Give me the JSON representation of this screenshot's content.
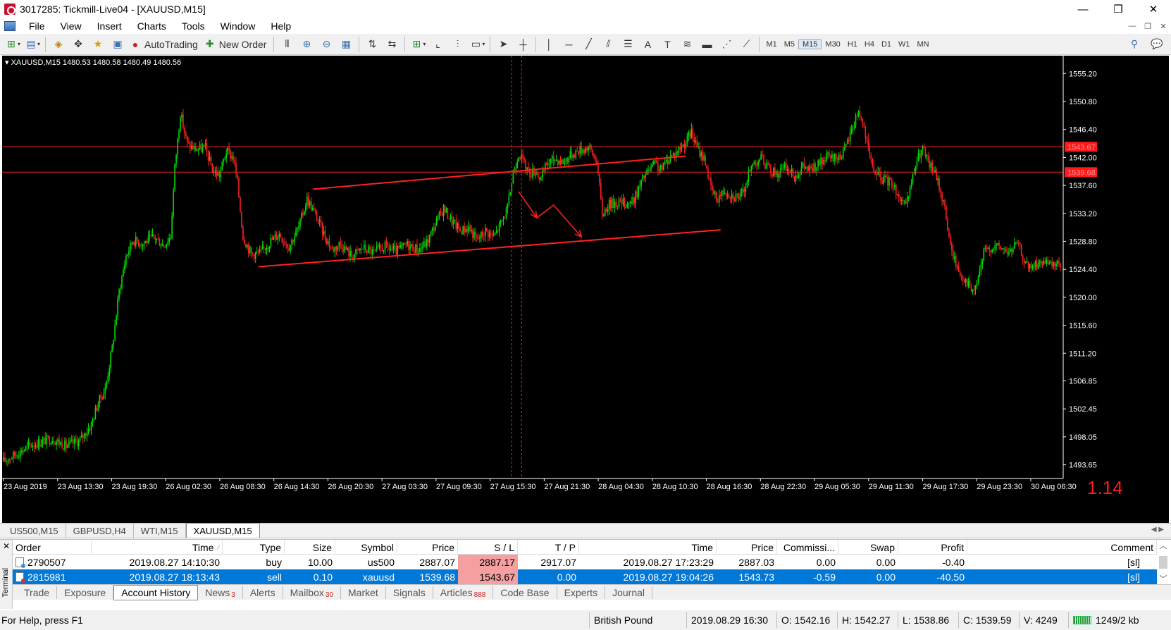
{
  "window": {
    "title": "3017285: Tickmill-Live04 - [XAUUSD,M15]",
    "controls": [
      "—",
      "❐",
      "✕"
    ]
  },
  "menu": [
    "File",
    "View",
    "Insert",
    "Charts",
    "Tools",
    "Window",
    "Help"
  ],
  "toolbar": {
    "autotrading_label": "AutoTrading",
    "new_order_label": "New Order",
    "timeframes": [
      "M1",
      "M5",
      "M15",
      "M30",
      "H1",
      "H4",
      "D1",
      "W1",
      "MN"
    ],
    "selected_timeframe": "M15"
  },
  "chart": {
    "info": "XAUUSD,M15  1480.53 1480.58 1480.49 1480.56",
    "spread_value": "1.14",
    "price_ticks": [
      "1555.20",
      "1550.80",
      "1546.40",
      "1542.00",
      "1537.60",
      "1533.20",
      "1528.80",
      "1524.40",
      "1520.00",
      "1515.60",
      "1511.20",
      "1506.85",
      "1502.45",
      "1498.05",
      "1493.65"
    ],
    "price_tag_sl": "1543.67",
    "price_tag_entry": "1539.68",
    "time_ticks": [
      "23 Aug 2019",
      "23 Aug 13:30",
      "23 Aug 19:30",
      "26 Aug 02:30",
      "26 Aug 08:30",
      "26 Aug 14:30",
      "26 Aug 20:30",
      "27 Aug 03:30",
      "27 Aug 09:30",
      "27 Aug 15:30",
      "27 Aug 21:30",
      "28 Aug 04:30",
      "28 Aug 10:30",
      "28 Aug 16:30",
      "28 Aug 22:30",
      "29 Aug 05:30",
      "29 Aug 11:30",
      "29 Aug 17:30",
      "29 Aug 23:30",
      "30 Aug 06:30"
    ],
    "colors": {
      "background": "#000000",
      "up": "#00e000",
      "down": "#ff2020",
      "annotation": "#ff2020",
      "text": "#ffffff"
    }
  },
  "chart_data": {
    "type": "candlestick",
    "symbol": "XAUUSD",
    "timeframe": "M15",
    "ylim": [
      1491.5,
      1558.0
    ],
    "close_path": [
      [
        0,
        1494.2
      ],
      [
        20,
        1496.8
      ],
      [
        35,
        1497.8
      ],
      [
        45,
        1496.6
      ],
      [
        55,
        1497.5
      ],
      [
        63,
        1500.0
      ],
      [
        68,
        1503.5
      ],
      [
        73,
        1505.5
      ],
      [
        78,
        1512.0
      ],
      [
        83,
        1521.0
      ],
      [
        88,
        1526.5
      ],
      [
        93,
        1529.0
      ],
      [
        100,
        1528.5
      ],
      [
        108,
        1529.5
      ],
      [
        115,
        1528.2
      ],
      [
        120,
        1529.6
      ],
      [
        123,
        1540.5
      ],
      [
        127,
        1549.0
      ],
      [
        132,
        1544.0
      ],
      [
        138,
        1543.3
      ],
      [
        145,
        1543.5
      ],
      [
        150,
        1540.0
      ],
      [
        155,
        1539.2
      ],
      [
        160,
        1543.0
      ],
      [
        165,
        1542.0
      ],
      [
        168,
        1538.0
      ],
      [
        172,
        1529.5
      ],
      [
        178,
        1526.8
      ],
      [
        185,
        1527.0
      ],
      [
        190,
        1528.5
      ],
      [
        198,
        1530.0
      ],
      [
        205,
        1528.0
      ],
      [
        212,
        1531.0
      ],
      [
        218,
        1535.5
      ],
      [
        224,
        1533.0
      ],
      [
        230,
        1530.0
      ],
      [
        236,
        1527.5
      ],
      [
        242,
        1528.5
      ],
      [
        250,
        1526.5
      ],
      [
        258,
        1527.8
      ],
      [
        266,
        1527.0
      ],
      [
        274,
        1528.0
      ],
      [
        282,
        1527.2
      ],
      [
        290,
        1528.3
      ],
      [
        298,
        1527.5
      ],
      [
        304,
        1528.6
      ],
      [
        310,
        1531.5
      ],
      [
        316,
        1534.0
      ],
      [
        322,
        1532.0
      ],
      [
        328,
        1530.5
      ],
      [
        334,
        1531.0
      ],
      [
        340,
        1529.0
      ],
      [
        346,
        1530.5
      ],
      [
        352,
        1529.5
      ],
      [
        358,
        1532.0
      ],
      [
        362,
        1534.0
      ],
      [
        366,
        1539.5
      ],
      [
        370,
        1542.8
      ],
      [
        374,
        1541.0
      ],
      [
        378,
        1539.5
      ],
      [
        382,
        1540.0
      ],
      [
        386,
        1538.5
      ],
      [
        390,
        1541.0
      ],
      [
        396,
        1541.8
      ],
      [
        402,
        1541.3
      ],
      [
        408,
        1542.5
      ],
      [
        414,
        1543.2
      ],
      [
        420,
        1543.6
      ],
      [
        426,
        1541.5
      ],
      [
        430,
        1533.0
      ],
      [
        434,
        1534.5
      ],
      [
        440,
        1535.0
      ],
      [
        446,
        1534.8
      ],
      [
        452,
        1535.0
      ],
      [
        456,
        1537.0
      ],
      [
        460,
        1539.0
      ],
      [
        464,
        1540.0
      ],
      [
        468,
        1541.0
      ],
      [
        472,
        1540.0
      ],
      [
        478,
        1542.0
      ],
      [
        484,
        1543.0
      ],
      [
        490,
        1544.5
      ],
      [
        494,
        1546.0
      ],
      [
        498,
        1543.5
      ],
      [
        504,
        1541.5
      ],
      [
        508,
        1537.0
      ],
      [
        512,
        1535.5
      ],
      [
        518,
        1536.8
      ],
      [
        524,
        1536.0
      ],
      [
        530,
        1535.8
      ],
      [
        534,
        1538.5
      ],
      [
        538,
        1541.0
      ],
      [
        544,
        1542.0
      ],
      [
        550,
        1540.0
      ],
      [
        556,
        1539.5
      ],
      [
        562,
        1540.5
      ],
      [
        568,
        1539.0
      ],
      [
        574,
        1540.5
      ],
      [
        580,
        1540.0
      ],
      [
        586,
        1541.0
      ],
      [
        592,
        1542.0
      ],
      [
        598,
        1541.8
      ],
      [
        604,
        1543.0
      ],
      [
        610,
        1547.0
      ],
      [
        614,
        1549.5
      ],
      [
        618,
        1546.5
      ],
      [
        622,
        1542.0
      ],
      [
        626,
        1539.5
      ],
      [
        632,
        1538.5
      ],
      [
        638,
        1538.0
      ],
      [
        644,
        1535.5
      ],
      [
        648,
        1534.0
      ],
      [
        652,
        1538.0
      ],
      [
        656,
        1541.5
      ],
      [
        660,
        1543.5
      ],
      [
        664,
        1541.0
      ],
      [
        668,
        1540.0
      ],
      [
        672,
        1537.5
      ],
      [
        676,
        1534.0
      ],
      [
        680,
        1528.0
      ],
      [
        686,
        1524.0
      ],
      [
        692,
        1522.5
      ],
      [
        696,
        1520.5
      ],
      [
        700,
        1523.0
      ],
      [
        704,
        1527.0
      ],
      [
        710,
        1528.0
      ],
      [
        716,
        1527.8
      ],
      [
        722,
        1527.0
      ],
      [
        728,
        1528.5
      ],
      [
        732,
        1526.5
      ],
      [
        736,
        1524.5
      ],
      [
        740,
        1525.0
      ],
      [
        746,
        1525.5
      ],
      [
        752,
        1524.8
      ],
      [
        758,
        1525.2
      ]
    ],
    "horizontal_lines": [
      1543.67,
      1539.68
    ],
    "vertical_lines_at": [
      "27 Aug 15:30"
    ],
    "channel_bounds": {
      "upper_start": 1537.0,
      "upper_end": 1542.2,
      "lower_start": 1524.8,
      "lower_end": 1530.6
    }
  },
  "chart_tabs": [
    "US500,M15",
    "GBPUSD,H4",
    "WTI,M15",
    "XAUUSD,M15"
  ],
  "active_chart_tab": "XAUUSD,M15",
  "terminal": {
    "side_label": "Terminal",
    "columns": [
      "Order",
      "Time",
      "Type",
      "Size",
      "Symbol",
      "Price",
      "S / L",
      "T / P",
      "Time",
      "Price",
      "Commissi...",
      "Swap",
      "Profit",
      "Comment"
    ],
    "rows": [
      {
        "order": "2790507",
        "open_time": "2019.08.27 14:10:30",
        "type": "buy",
        "size": "10.00",
        "symbol": "us500",
        "price": "2887.07",
        "sl": "2887.17",
        "tp": "2917.07",
        "close_time": "2019.08.27 17:23:29",
        "close_price": "2887.03",
        "commission": "0.00",
        "swap": "0.00",
        "profit": "-0.40",
        "comment": "[sl]"
      },
      {
        "order": "2815981",
        "open_time": "2019.08.27 18:13:43",
        "type": "sell",
        "size": "0.10",
        "symbol": "xauusd",
        "price": "1539.68",
        "sl": "1543.67",
        "tp": "0.00",
        "close_time": "2019.08.27 19:04:26",
        "close_price": "1543.73",
        "commission": "-0.59",
        "swap": "0.00",
        "profit": "-40.50",
        "comment": "[sl]"
      }
    ],
    "tabs": [
      {
        "label": "Trade",
        "badge": ""
      },
      {
        "label": "Exposure",
        "badge": ""
      },
      {
        "label": "Account History",
        "badge": ""
      },
      {
        "label": "News",
        "badge": "3"
      },
      {
        "label": "Alerts",
        "badge": ""
      },
      {
        "label": "Mailbox",
        "badge": "30"
      },
      {
        "label": "Market",
        "badge": ""
      },
      {
        "label": "Signals",
        "badge": ""
      },
      {
        "label": "Articles",
        "badge": "888"
      },
      {
        "label": "Code Base",
        "badge": ""
      },
      {
        "label": "Experts",
        "badge": ""
      },
      {
        "label": "Journal",
        "badge": ""
      }
    ],
    "active_tab": "Account History"
  },
  "status": {
    "help": "For Help, press F1",
    "profile": "British Pound",
    "datetime": "2019.08.29 16:30",
    "open": "O: 1542.16",
    "high": "H: 1542.27",
    "low": "L: 1538.86",
    "close": "C: 1539.59",
    "volume": "V: 4249",
    "traffic": "1249/2 kb"
  }
}
